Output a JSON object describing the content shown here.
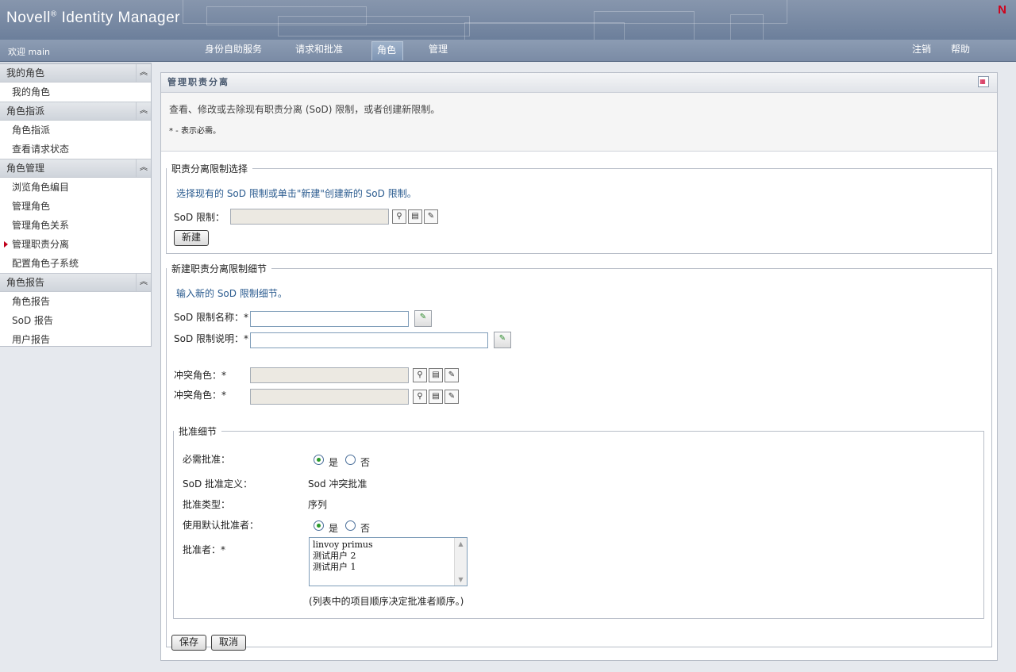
{
  "header": {
    "product": "Novell",
    "reg_mark": "®",
    "app_name": "Identity Manager",
    "logo_letter": "N"
  },
  "nav": {
    "welcome": "欢迎 main",
    "tabs": [
      "身份自助服务",
      "请求和批准",
      "角色",
      "管理"
    ],
    "active_tab": "角色",
    "logout": "注销",
    "help": "帮助"
  },
  "sidebar": {
    "sections": [
      {
        "title": "我的角色",
        "items": [
          "我的角色"
        ]
      },
      {
        "title": "角色指派",
        "items": [
          "角色指派",
          "查看请求状态"
        ]
      },
      {
        "title": "角色管理",
        "items": [
          "浏览角色编目",
          "管理角色",
          "管理角色关系",
          "管理职责分离",
          "配置角色子系统"
        ]
      },
      {
        "title": "角色报告",
        "items": [
          "角色报告",
          "SoD 报告",
          "用户报告"
        ]
      }
    ],
    "current_item": "管理职责分离",
    "collapse_glyph": "︽"
  },
  "panel": {
    "title": "管理职责分离",
    "description": "查看、修改或去除现有职责分离 (SoD) 限制，或者创建新限制。",
    "required_note": "* - 表示必需。"
  },
  "select_section": {
    "legend": "职责分离限制选择",
    "hint": "选择现有的 SoD 限制或单击\"新建\"创建新的 SoD 限制。",
    "sod_label": "SoD 限制：",
    "sod_value": "",
    "new_button": "新建"
  },
  "details_section": {
    "legend": "新建职责分离限制细节",
    "hint": "输入新的 SoD 限制细节。",
    "name_label": "SoD 限制名称：*",
    "name_value": "",
    "desc_label": "SoD 限制说明：*",
    "desc_value": "",
    "conflict_label_1": "冲突角色：*",
    "conflict_label_2": "冲突角色：*"
  },
  "approval": {
    "legend": "批准细节",
    "required_label": "必需批准：",
    "required_value": "是",
    "yes": "是",
    "no": "否",
    "definition_label": "SoD 批准定义：",
    "definition_value": "Sod 冲突批准",
    "type_label": "批准类型：",
    "type_value": "序列",
    "default_label": "使用默认批准者：",
    "default_value": "是",
    "approvers_label": "批准者：*",
    "approvers": [
      "linvoy primus",
      "测试用户 2",
      "测试用户 1"
    ],
    "order_note": "(列表中的项目顺序决定批准者顺序。)"
  },
  "actions": {
    "save": "保存",
    "cancel": "取消"
  },
  "icons": {
    "search": "magnifier-icon",
    "history": "history-icon",
    "edit": "edit-icon",
    "wizard": "language-wizard-icon"
  },
  "colors": {
    "header": "#6c7f9b",
    "hint": "#2a5b8f",
    "current_marker": "#c0001b"
  }
}
